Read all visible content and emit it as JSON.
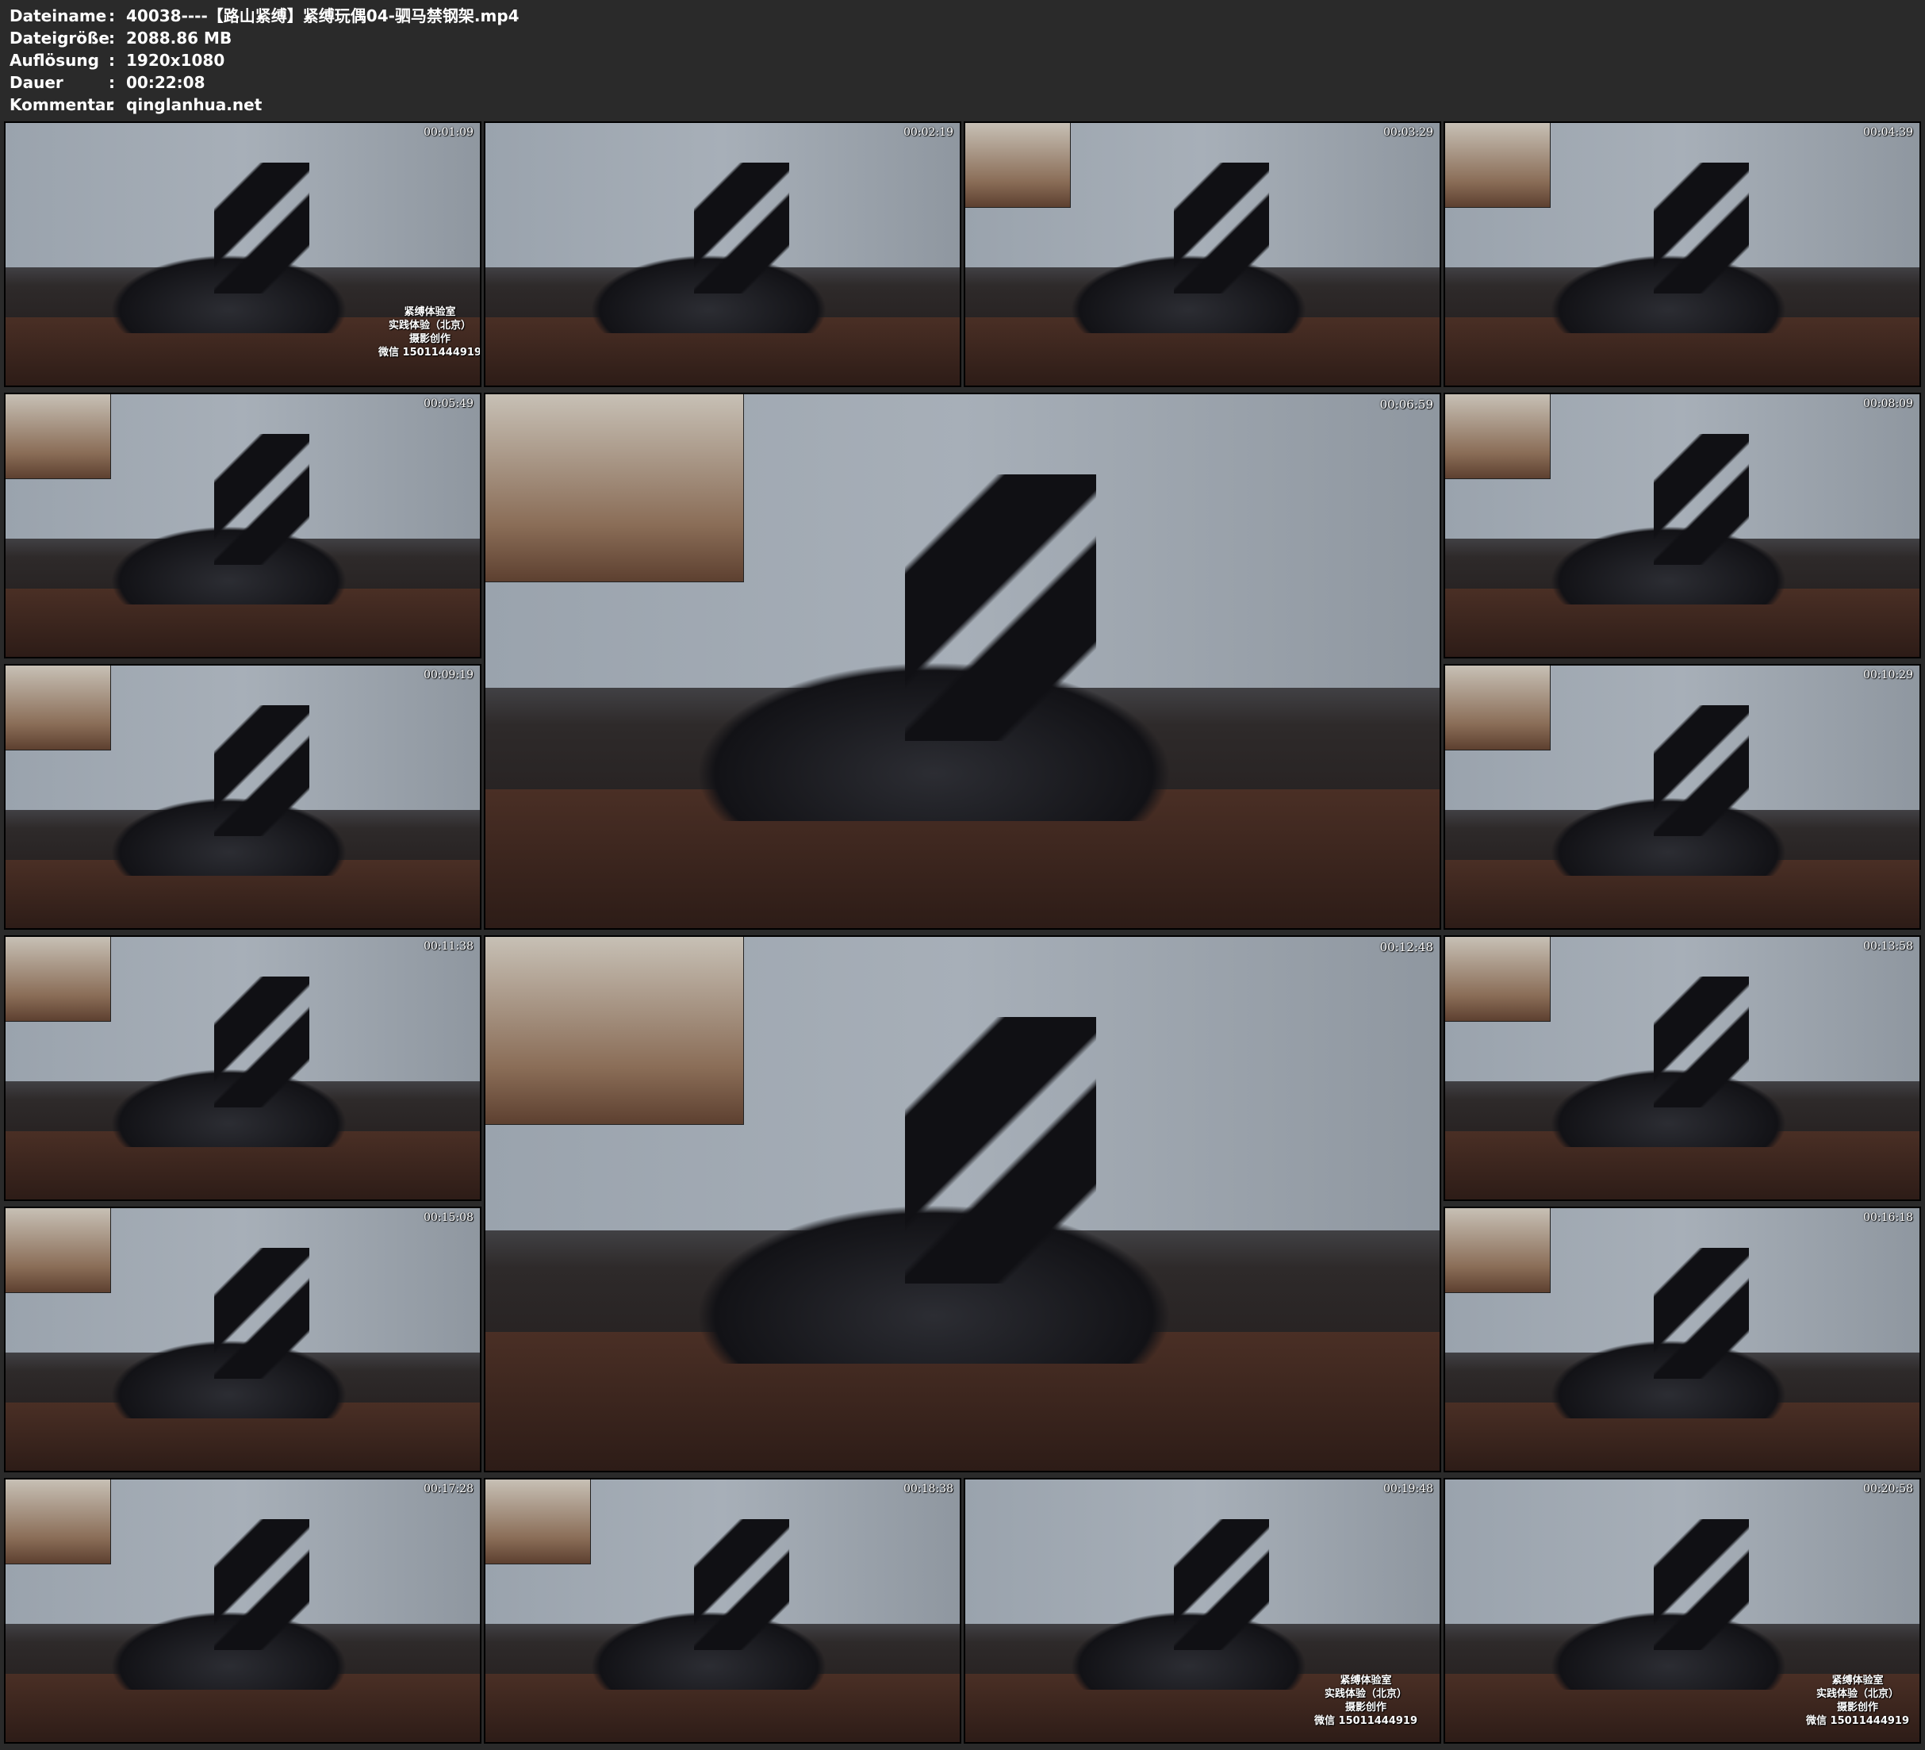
{
  "header": {
    "rows": [
      {
        "key": "Dateiname",
        "sep": ":",
        "value": "40038----【路山紧缚】紧缚玩偶04-驷马禁钢架.mp4"
      },
      {
        "key": "Dateigröße",
        "sep": ":",
        "value": "2088.86 MB"
      },
      {
        "key": "Auflösung",
        "sep": ":",
        "value": "1920x1080"
      },
      {
        "key": "Dauer",
        "sep": ":",
        "value": "00:22:08"
      },
      {
        "key": "Kommentar",
        "sep": ":",
        "value": "qinglanhua.net"
      }
    ]
  },
  "thumbnails": [
    {
      "timestamp": "00:01:09",
      "watermark": [
        "紧缚体验室",
        "实践体验（北京）",
        "摄影创作",
        "微信 15011444919"
      ]
    },
    {
      "timestamp": "00:02:19"
    },
    {
      "timestamp": "00:03:29"
    },
    {
      "timestamp": "00:04:39"
    },
    {
      "timestamp": "00:05:49"
    },
    {
      "timestamp": "00:06:59"
    },
    {
      "timestamp": "00:08:09"
    },
    {
      "timestamp": "00:09:19"
    },
    {
      "timestamp": "00:10:29"
    },
    {
      "timestamp": "00:11:38"
    },
    {
      "timestamp": "00:12:48"
    },
    {
      "timestamp": "00:13:58"
    },
    {
      "timestamp": "00:15:08"
    },
    {
      "timestamp": "00:16:18"
    },
    {
      "timestamp": "00:17:28"
    },
    {
      "timestamp": "00:18:38"
    },
    {
      "timestamp": "00:19:48",
      "watermark": [
        "紧缚体验室",
        "实践体验（北京）",
        "摄影创作",
        "微信 15011444919"
      ]
    },
    {
      "timestamp": "00:20:58",
      "watermark": [
        "紧缚体验室",
        "实践体验（北京）",
        "摄影创作",
        "微信 15011444919"
      ]
    }
  ]
}
